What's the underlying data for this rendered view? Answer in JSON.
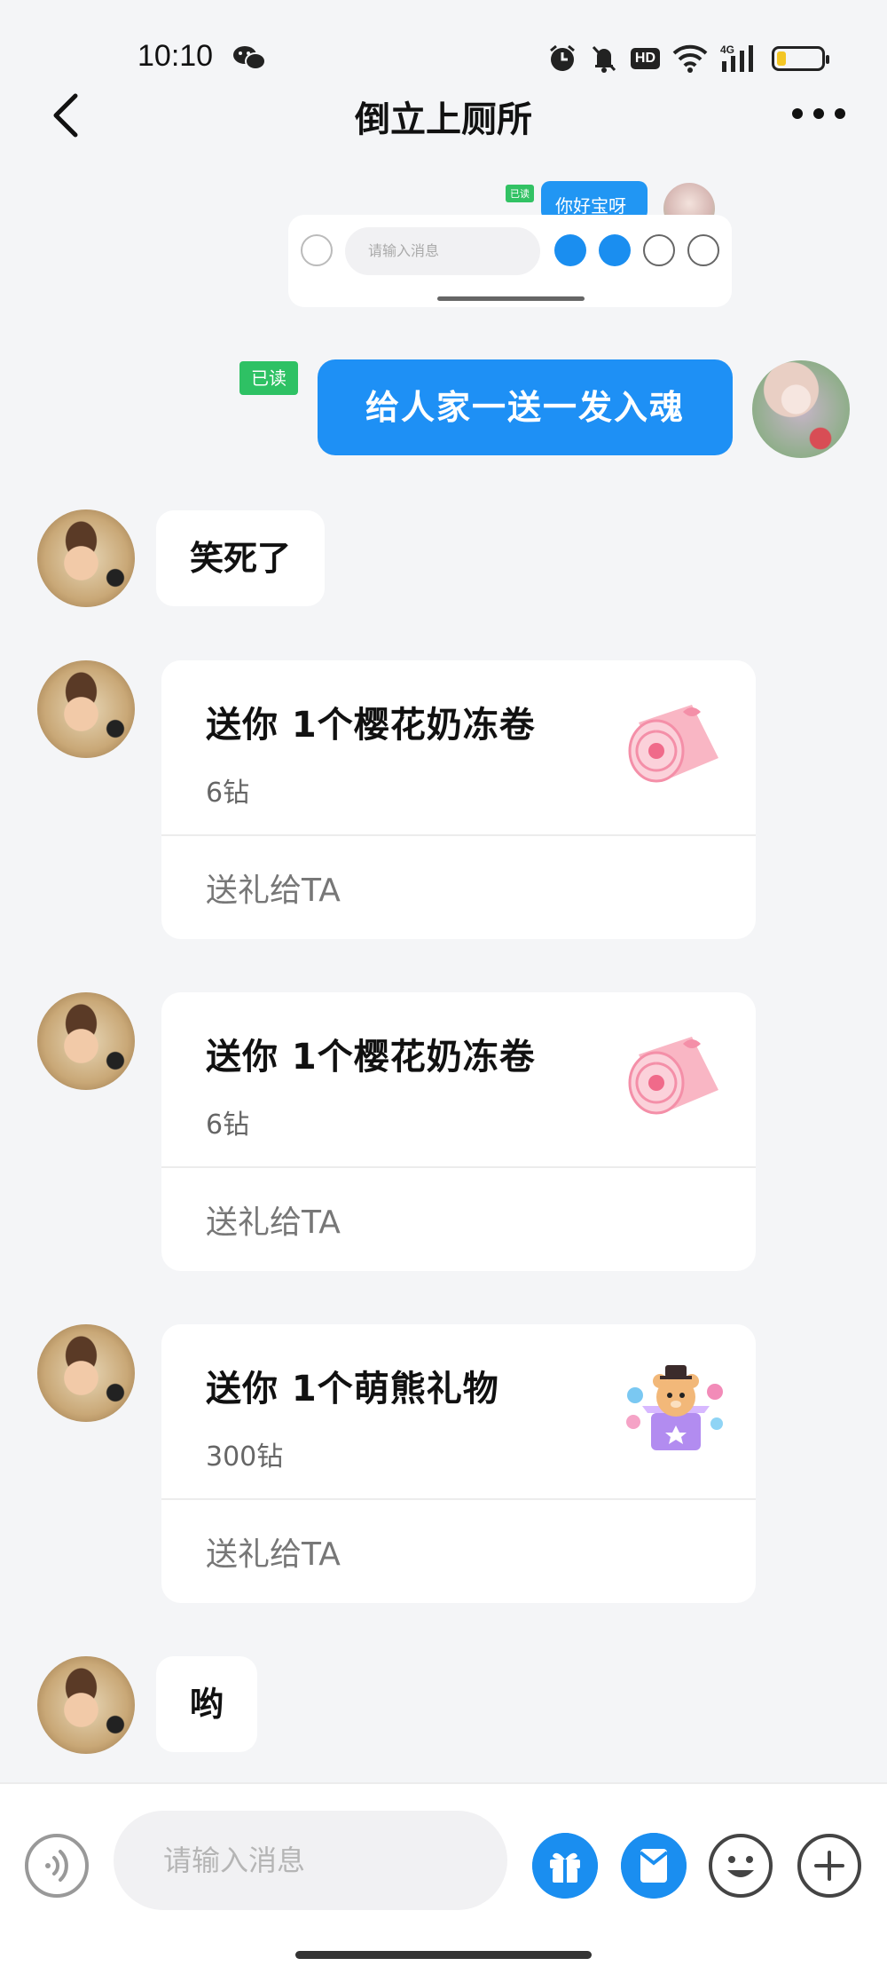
{
  "status_bar": {
    "time": "10:10",
    "network": "4G",
    "hd": "HD",
    "battery_level": 0.2
  },
  "header": {
    "title": "倒立上厕所"
  },
  "embedded_screenshot": {
    "read_label": "已读",
    "bubble_text": "你好宝呀",
    "input_placeholder": "请输入消息"
  },
  "messages": {
    "outgoing_1": {
      "read_label": "已读",
      "text": "给人家一送一发入魂"
    },
    "incoming_1": {
      "text": "笑死了"
    },
    "gift_1": {
      "title": "送你 1个樱花奶冻卷",
      "price": "6钻",
      "action": "送礼给TA",
      "image": "sakura-milk-roll-icon"
    },
    "gift_2": {
      "title": "送你 1个樱花奶冻卷",
      "price": "6钻",
      "action": "送礼给TA",
      "image": "sakura-milk-roll-icon"
    },
    "gift_3": {
      "title": "送你 1个萌熊礼物",
      "price": "300钻",
      "action": "送礼给TA",
      "image": "cute-bear-gift-icon"
    },
    "incoming_2": {
      "text": "哟"
    }
  },
  "input_bar": {
    "placeholder": "请输入消息"
  },
  "colors": {
    "accent": "#1e90f5",
    "read_badge": "#2ec164",
    "background": "#f4f5f7"
  }
}
